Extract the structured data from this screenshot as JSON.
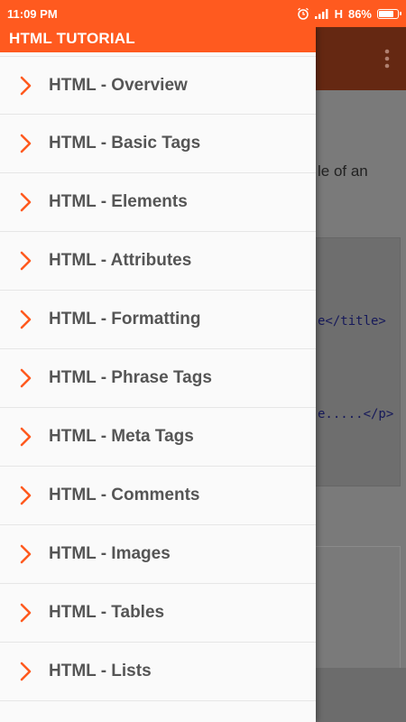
{
  "status_bar": {
    "time": "11:09 PM",
    "network": "H",
    "battery": "86%",
    "battery_level": 0.86,
    "icons": [
      "alarm-icon",
      "signal-icon",
      "battery-icon"
    ]
  },
  "colors": {
    "accent": "#ff5a1f",
    "drawer_bg": "#fafafa",
    "chevron": "#ff5a1f"
  },
  "drawer": {
    "title": "HTML TUTORIAL",
    "items": [
      {
        "label": "HTML - Overview"
      },
      {
        "label": "HTML - Basic Tags"
      },
      {
        "label": "HTML - Elements"
      },
      {
        "label": "HTML - Attributes"
      },
      {
        "label": "HTML - Formatting"
      },
      {
        "label": "HTML - Phrase Tags"
      },
      {
        "label": "HTML - Meta Tags"
      },
      {
        "label": "HTML - Comments"
      },
      {
        "label": "HTML - Images"
      },
      {
        "label": "HTML - Tables"
      },
      {
        "label": "HTML - Lists"
      }
    ]
  },
  "background": {
    "text_fragment": "le of an",
    "code_line1": "e</title>",
    "code_line2": "e.....</p>",
    "menu_icon": "overflow-menu-icon"
  }
}
